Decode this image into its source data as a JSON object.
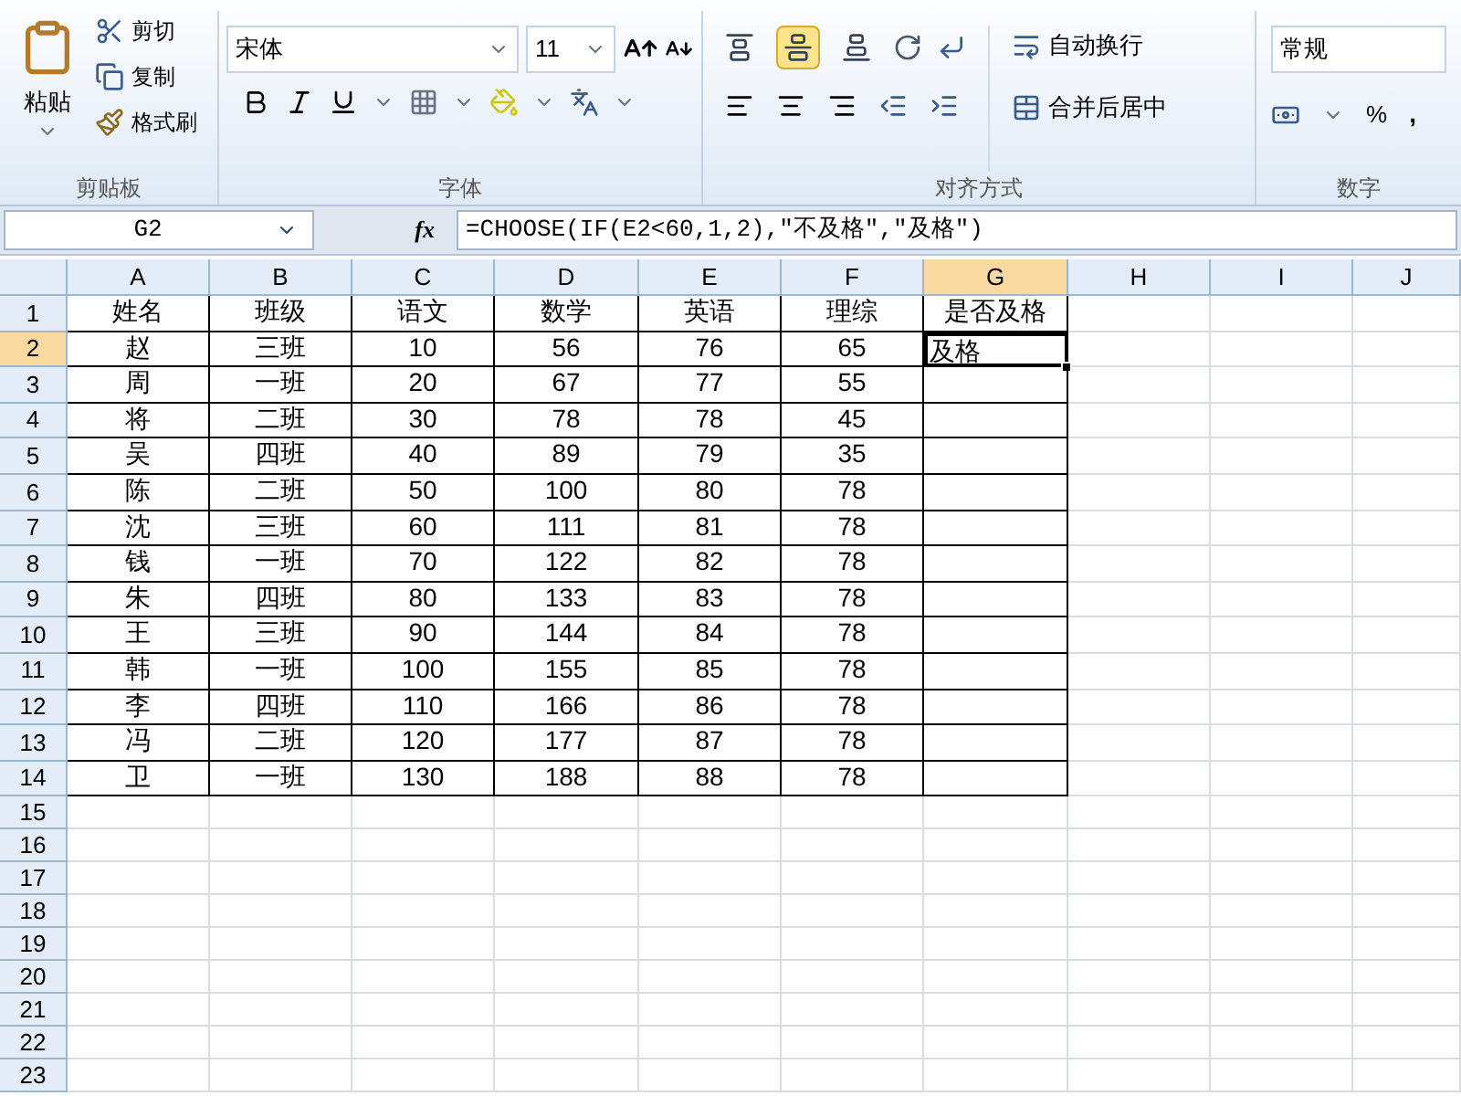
{
  "ribbon": {
    "clipboard": {
      "paste": "粘贴",
      "cut": "剪切",
      "copy": "复制",
      "format_painter": "格式刷",
      "label": "剪贴板"
    },
    "font": {
      "font_name": "宋体",
      "font_size": "11",
      "label": "字体"
    },
    "alignment": {
      "vertical": [
        {
          "kind": "top",
          "selected": false
        },
        {
          "kind": "middle",
          "selected": true
        },
        {
          "kind": "bottom",
          "selected": false
        }
      ],
      "wrap": "自动换行",
      "merge": "合并后居中",
      "label": "对齐方式"
    },
    "number": {
      "format": "常规",
      "percent": "%",
      "comma": ",",
      "label": "数字"
    }
  },
  "formula_bar": {
    "name_box": "G2",
    "function_label": "fx",
    "formula": "=CHOOSE(IF(E2<60,1,2),\"不及格\",\"及格\")"
  },
  "columns": [
    {
      "letter": "A",
      "selected": false
    },
    {
      "letter": "B",
      "selected": false
    },
    {
      "letter": "C",
      "selected": false
    },
    {
      "letter": "D",
      "selected": false
    },
    {
      "letter": "E",
      "selected": false
    },
    {
      "letter": "F",
      "selected": false
    },
    {
      "letter": "G",
      "selected": true
    },
    {
      "letter": "H",
      "selected": false
    },
    {
      "letter": "I",
      "selected": false
    },
    {
      "letter": "J",
      "selected": false
    }
  ],
  "rows": [
    {
      "number": "1",
      "selected": false,
      "cells": [
        "姓名",
        "班级",
        "语文",
        "数学",
        "英语",
        "理综",
        "是否及格"
      ]
    },
    {
      "number": "2",
      "selected": true,
      "cells": [
        "赵",
        "三班",
        "10",
        "56",
        "76",
        "65",
        "及格"
      ]
    },
    {
      "number": "3",
      "selected": false,
      "cells": [
        "周",
        "一班",
        "20",
        "67",
        "77",
        "55"
      ]
    },
    {
      "number": "4",
      "selected": false,
      "cells": [
        "将",
        "二班",
        "30",
        "78",
        "78",
        "45"
      ]
    },
    {
      "number": "5",
      "selected": false,
      "cells": [
        "吴",
        "四班",
        "40",
        "89",
        "79",
        "35"
      ]
    },
    {
      "number": "6",
      "selected": false,
      "cells": [
        "陈",
        "二班",
        "50",
        "100",
        "80",
        "78"
      ]
    },
    {
      "number": "7",
      "selected": false,
      "cells": [
        "沈",
        "三班",
        "60",
        "111",
        "81",
        "78"
      ]
    },
    {
      "number": "8",
      "selected": false,
      "cells": [
        "钱",
        "一班",
        "70",
        "122",
        "82",
        "78"
      ]
    },
    {
      "number": "9",
      "selected": false,
      "cells": [
        "朱",
        "四班",
        "80",
        "133",
        "83",
        "78"
      ]
    },
    {
      "number": "10",
      "selected": false,
      "cells": [
        "王",
        "三班",
        "90",
        "144",
        "84",
        "78"
      ]
    },
    {
      "number": "11",
      "selected": false,
      "cells": [
        "韩",
        "一班",
        "100",
        "155",
        "85",
        "78"
      ]
    },
    {
      "number": "12",
      "selected": false,
      "cells": [
        "李",
        "四班",
        "110",
        "166",
        "86",
        "78"
      ]
    },
    {
      "number": "13",
      "selected": false,
      "cells": [
        "冯",
        "二班",
        "120",
        "177",
        "87",
        "78"
      ]
    },
    {
      "number": "14",
      "selected": false,
      "cells": [
        "卫",
        "一班",
        "130",
        "188",
        "88",
        "78"
      ]
    },
    {
      "number": "15",
      "selected": false
    },
    {
      "number": "16",
      "selected": false
    },
    {
      "number": "17",
      "selected": false
    },
    {
      "number": "18",
      "selected": false
    },
    {
      "number": "19",
      "selected": false
    },
    {
      "number": "20",
      "selected": false
    },
    {
      "number": "21",
      "selected": false
    },
    {
      "number": "22",
      "selected": false
    },
    {
      "number": "23",
      "selected": false
    }
  ]
}
